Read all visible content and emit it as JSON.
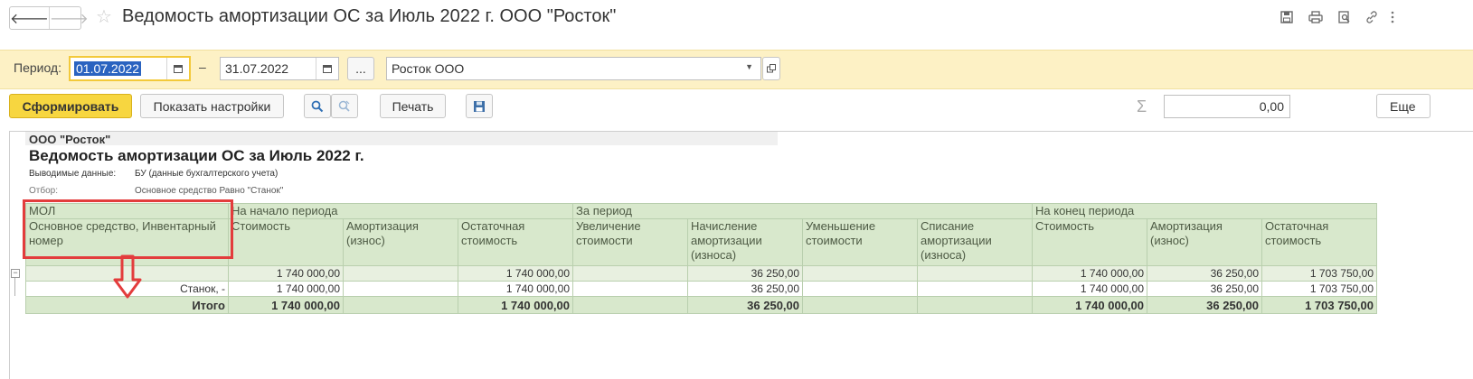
{
  "window": {
    "title": "Ведомость амортизации ОС за Июль 2022 г. ООО \"Росток\""
  },
  "nav": {
    "back": "🡐",
    "forward": "🡒",
    "star": "☆"
  },
  "title_icons": [
    "save-icon",
    "print-icon",
    "preview-icon",
    "link-icon",
    "more-icon"
  ],
  "period": {
    "label": "Период:",
    "from": "01.07.2022",
    "dash": "–",
    "to": "31.07.2022",
    "ellipsis": "...",
    "organization": "Росток ООО"
  },
  "toolbar": {
    "generate": "Сформировать",
    "settings": "Показать настройки",
    "print": "Печать",
    "sum_symbol": "Σ",
    "sum_value": "0,00",
    "more": "Еще"
  },
  "report": {
    "org": "ООО \"Росток\"",
    "title": "Ведомость амортизации ОС за Июль 2022 г.",
    "output_label": "Выводимые данные:",
    "output_value": "БУ (данные бухгалтерского учета)",
    "filter_label": "Отбор:",
    "filter_value": "Основное средство Равно \"Станок\"",
    "groups": {
      "mol": "МОЛ",
      "start": "На начало периода",
      "period": "За период",
      "end": "На конец периода"
    },
    "headers": {
      "asset": "Основное средство, Инвентарный номер",
      "cost": "Стоимость",
      "amort": "Амортизация (износ)",
      "residual": "Остаточная стоимость",
      "increase": "Увеличение стоимости",
      "accrual": "Начисление амортизации (износа)",
      "decrease": "Уменьшение стоимости",
      "writeoff": "Списание амортизации (износа)",
      "cost_end": "Стоимость",
      "amort_end": "Амортизация (износ)",
      "residual_end": "Остаточная стоимость"
    },
    "rows": {
      "group": {
        "name": "",
        "cost": "1 740 000,00",
        "amort": "",
        "residual": "1 740 000,00",
        "increase": "",
        "accrual": "36 250,00",
        "decrease": "",
        "writeoff": "",
        "cost_end": "1 740 000,00",
        "amort_end": "36 250,00",
        "residual_end": "1 703 750,00"
      },
      "detail": {
        "name": "Станок, -",
        "cost": "1 740 000,00",
        "amort": "",
        "residual": "1 740 000,00",
        "increase": "",
        "accrual": "36 250,00",
        "decrease": "",
        "writeoff": "",
        "cost_end": "1 740 000,00",
        "amort_end": "36 250,00",
        "residual_end": "1 703 750,00"
      },
      "total": {
        "name": "Итого",
        "cost": "1 740 000,00",
        "amort": "",
        "residual": "1 740 000,00",
        "increase": "",
        "accrual": "36 250,00",
        "decrease": "",
        "writeoff": "",
        "cost_end": "1 740 000,00",
        "amort_end": "36 250,00",
        "residual_end": "1 703 750,00"
      }
    }
  },
  "annotation": {
    "color": "#e33c3c"
  },
  "colors": {
    "accent_yellow": "#f7d640",
    "band": "#fdf1c5",
    "grid_header": "#d8e8cc"
  }
}
